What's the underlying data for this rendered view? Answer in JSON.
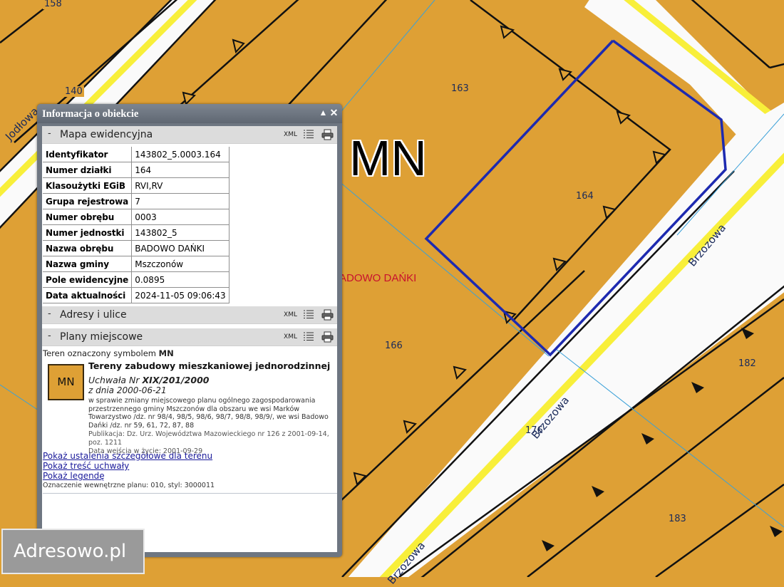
{
  "map": {
    "zone_symbol": "MN",
    "precinct_label": "BADOWO DAŃKI",
    "plot_numbers": [
      "158",
      "140",
      "163",
      "164",
      "166",
      "176",
      "182",
      "183"
    ],
    "streets": [
      "Jodłowa",
      "Brzozowa",
      "Brzozowa",
      "Brzozowa"
    ],
    "colors": {
      "plot_fill": "#dea035",
      "road": "#fafafa",
      "road_line": "#f8ef3a",
      "selected_outline": "#1d2ab0",
      "panel_frame": "#6e7681"
    }
  },
  "panel": {
    "title": "Informacja o obiekcie",
    "collapse_icon": "triangle-up-icon",
    "close_icon": "close-icon",
    "sections": {
      "map": {
        "toggle": "-",
        "title": "Mapa ewidencyjna",
        "xml": "XML"
      },
      "addresses": {
        "toggle": "-",
        "title": "Adresy i ulice",
        "xml": "XML"
      },
      "plans": {
        "toggle": "-",
        "title": "Plany miejscowe",
        "xml": "XML"
      }
    },
    "attributes": [
      {
        "key": "Identyfikator",
        "value": "143802_5.0003.164"
      },
      {
        "key": "Numer działki",
        "value": "164"
      },
      {
        "key": "Klasoużytki EGiB",
        "value": "RVI,RV"
      },
      {
        "key": "Grupa rejestrowa",
        "value": "7"
      },
      {
        "key": "Numer obrębu",
        "value": "0003"
      },
      {
        "key": "Numer jednostki",
        "value": "143802_5"
      },
      {
        "key": "Nazwa obrębu",
        "value": "BADOWO DAŃKI"
      },
      {
        "key": "Nazwa gminy",
        "value": "Mszczonów"
      },
      {
        "key": "Pole ewidencyjne",
        "value": "0.0895"
      },
      {
        "key": "Data aktualności",
        "value": "2024-11-05 09:06:43"
      }
    ],
    "plans": {
      "intro": "Teren oznaczony symbolem",
      "symbol": "MN",
      "icon_label": "MN",
      "name": "Tereny zabudowy mieszkaniowej jednorodzinnej",
      "resolution_prefix": "Uchwała Nr",
      "resolution_number": "XIX/201/2000",
      "date": "z dnia 2000-06-21",
      "description": "w sprawie zmiany miejscowego planu ogólnego zagospodarowania przestrzennego gminy Mszczonów dla obszaru we wsi Marków Towarzystwo /dz. nr 98/4, 98/5, 98/6, 98/7, 98/8, 98/9/, we wsi Badowo Dańki /dz. nr 59, 61, 72, 87, 88",
      "publication": "Publikacja: Dz. Urz. Województwa Mazowieckiego nr 126 z 2001-09-14, poz. 1211",
      "effective": "Data wejścia w życie: 2001-09-29",
      "links": [
        "Pokaż ustalenia szczegółowe dla terenu",
        "Pokaż treść uchwały",
        "Pokaż legendę"
      ],
      "internal": "Oznaczenie wewnętrzne planu: 010, styl: 3000011"
    }
  },
  "watermark": "Adresowo.pl"
}
